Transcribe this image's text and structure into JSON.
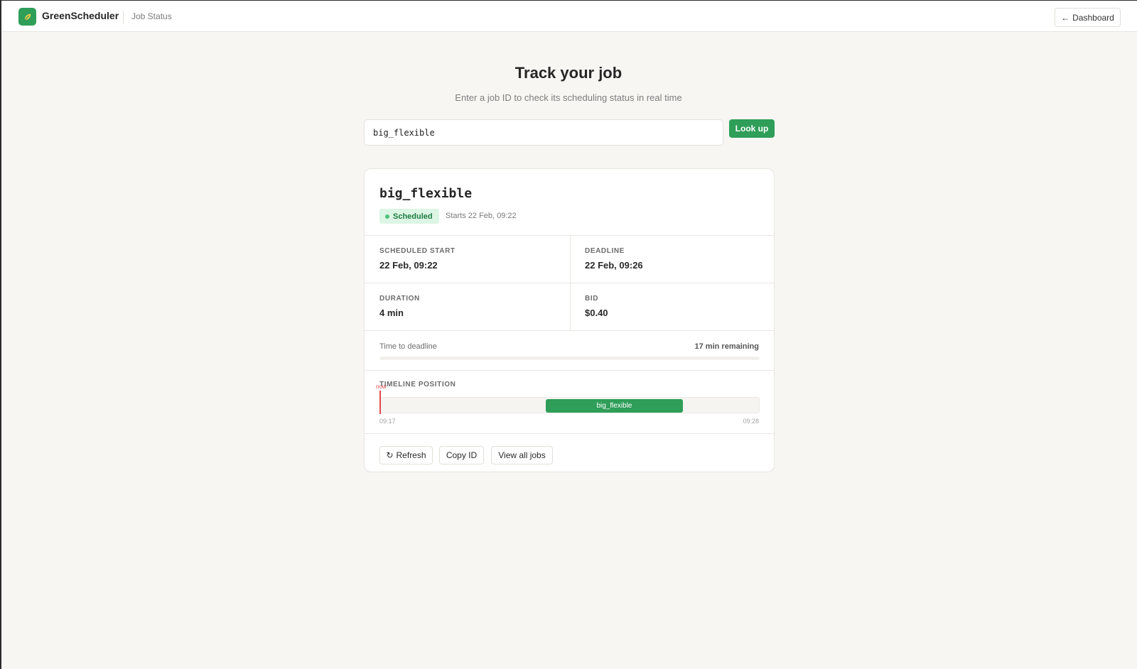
{
  "app": {
    "name": "GreenScheduler",
    "breadcrumb": "Job Status",
    "dashboard_label": "Dashboard",
    "logo_icon": "leaf-icon",
    "accent_color": "#2e9e58"
  },
  "header": {
    "title": "Track your job",
    "subtitle": "Enter a job ID to check its scheduling status in real time"
  },
  "search": {
    "value": "big_flexible",
    "button_label": "Look up"
  },
  "job": {
    "id": "big_flexible",
    "status": "Scheduled",
    "status_color": "#1e7a42",
    "starts_text": "Starts 22 Feb, 09:22",
    "fields": {
      "scheduled_start": {
        "label": "Scheduled start",
        "value": "22 Feb, 09:22"
      },
      "deadline": {
        "label": "Deadline",
        "value": "22 Feb, 09:26"
      },
      "duration": {
        "label": "Duration",
        "value": "4 min"
      },
      "bid": {
        "label": "Bid",
        "value": "$0.40"
      }
    },
    "time_to_deadline": {
      "label": "Time to deadline",
      "remaining": "17 min remaining",
      "progress_fraction": 0.0
    },
    "timeline": {
      "label": "TIMELINE POSITION",
      "now_label": "now",
      "start_label": "09:17",
      "end_label": "09:28",
      "block_label": "big_flexible",
      "range_start_min": 557,
      "range_end_min": 568,
      "now_min": 557,
      "block_start_min": 561.8,
      "block_end_min": 565.8
    }
  },
  "actions": {
    "refresh_label": "Refresh",
    "copy_label": "Copy ID",
    "view_all_label": "View all jobs"
  }
}
